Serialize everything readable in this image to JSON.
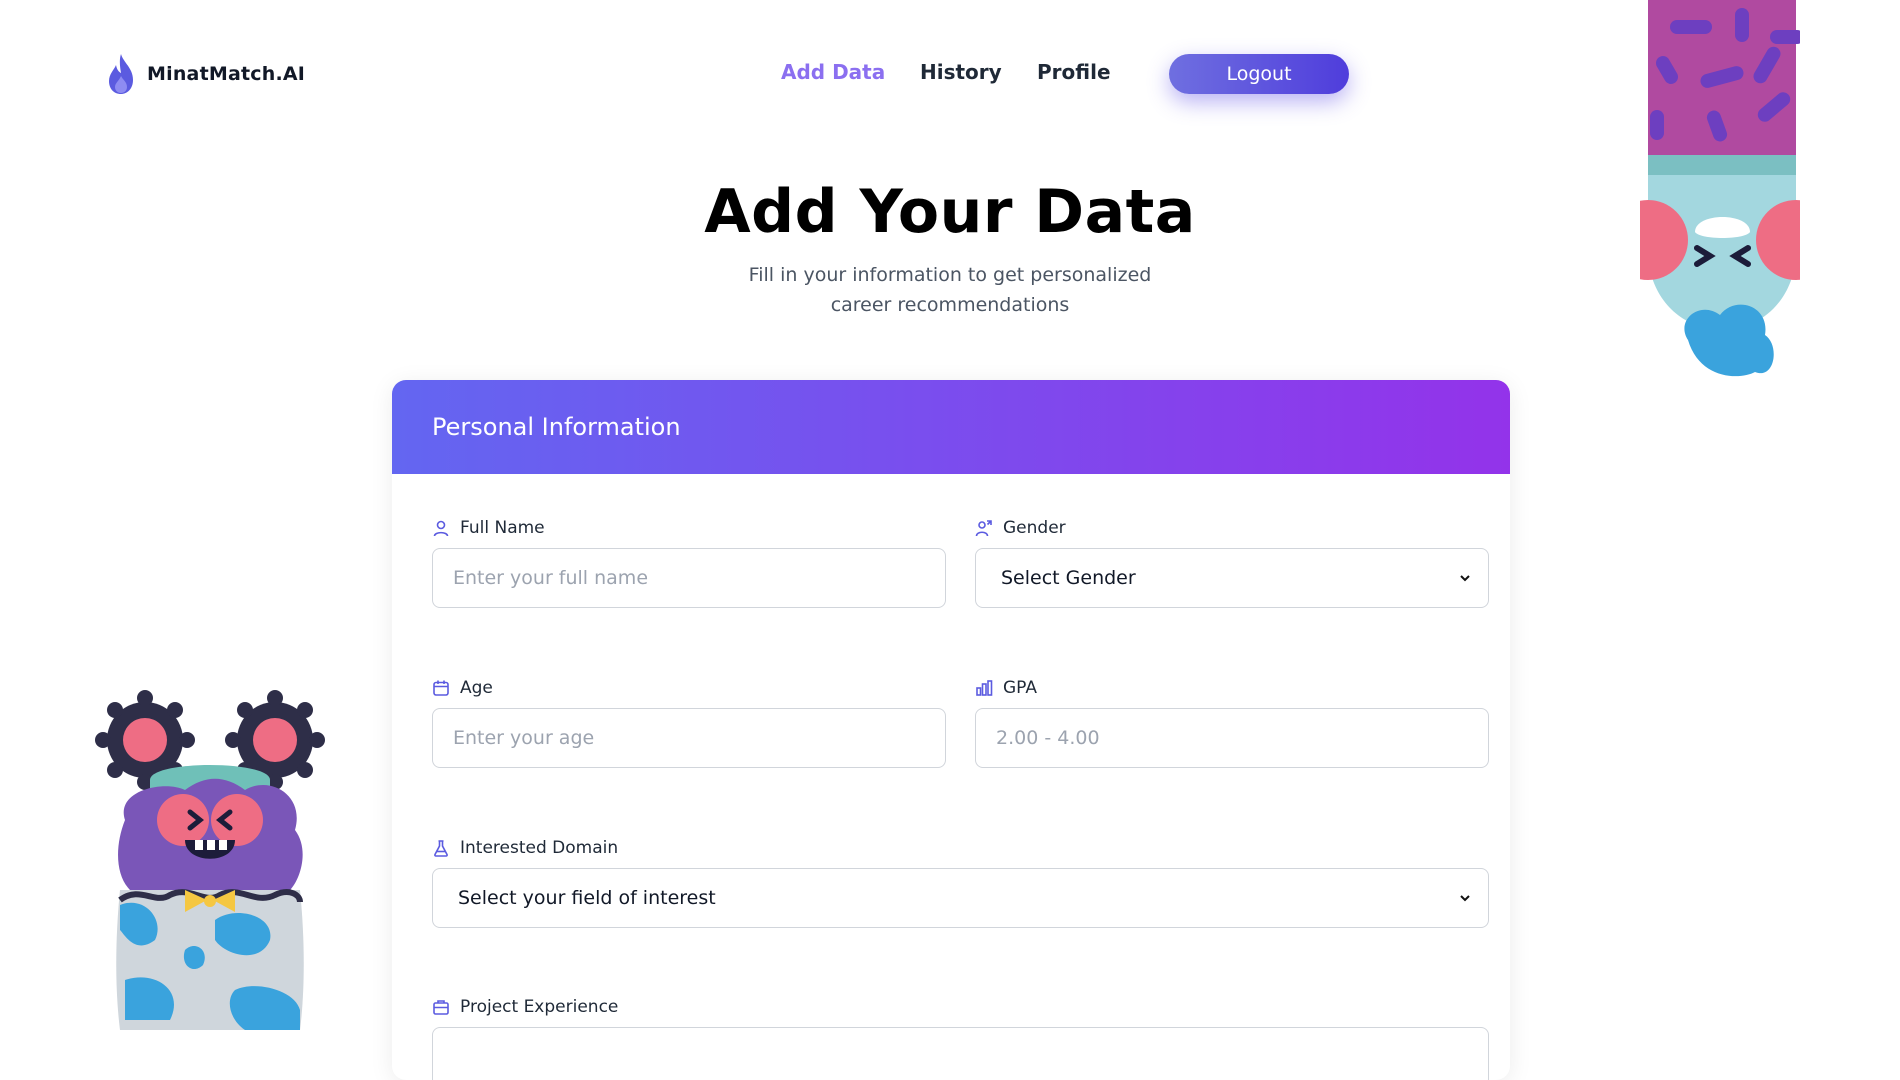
{
  "brand": {
    "name": "MinatMatch.AI",
    "logo_icon": "flame-icon",
    "accent": "#6366f1"
  },
  "nav": {
    "items": [
      {
        "label": "Add Data",
        "active": true
      },
      {
        "label": "History",
        "active": false
      },
      {
        "label": "Profile",
        "active": false
      }
    ],
    "logout_label": "Logout"
  },
  "hero": {
    "title": "Add Your Data",
    "subtitle": "Fill in your information to get personalized career recommendations"
  },
  "form": {
    "section_title": "Personal Information",
    "full_name": {
      "label": "Full Name",
      "placeholder": "Enter your full name",
      "icon": "user-icon"
    },
    "gender": {
      "label": "Gender",
      "value": "Select Gender",
      "icon": "gender-icon"
    },
    "age": {
      "label": "Age",
      "placeholder": "Enter your age",
      "icon": "calendar-icon"
    },
    "gpa": {
      "label": "GPA",
      "placeholder": "2.00 - 4.00",
      "icon": "bar-chart-icon"
    },
    "domain": {
      "label": "Interested Domain",
      "value": "Select your field of interest",
      "icon": "flask-icon"
    },
    "project": {
      "label": "Project Experience",
      "icon": "briefcase-icon"
    }
  },
  "colors": {
    "gradient_start": "#6366f1",
    "gradient_end": "#9333ea",
    "active_nav": "#8b6ff0"
  }
}
